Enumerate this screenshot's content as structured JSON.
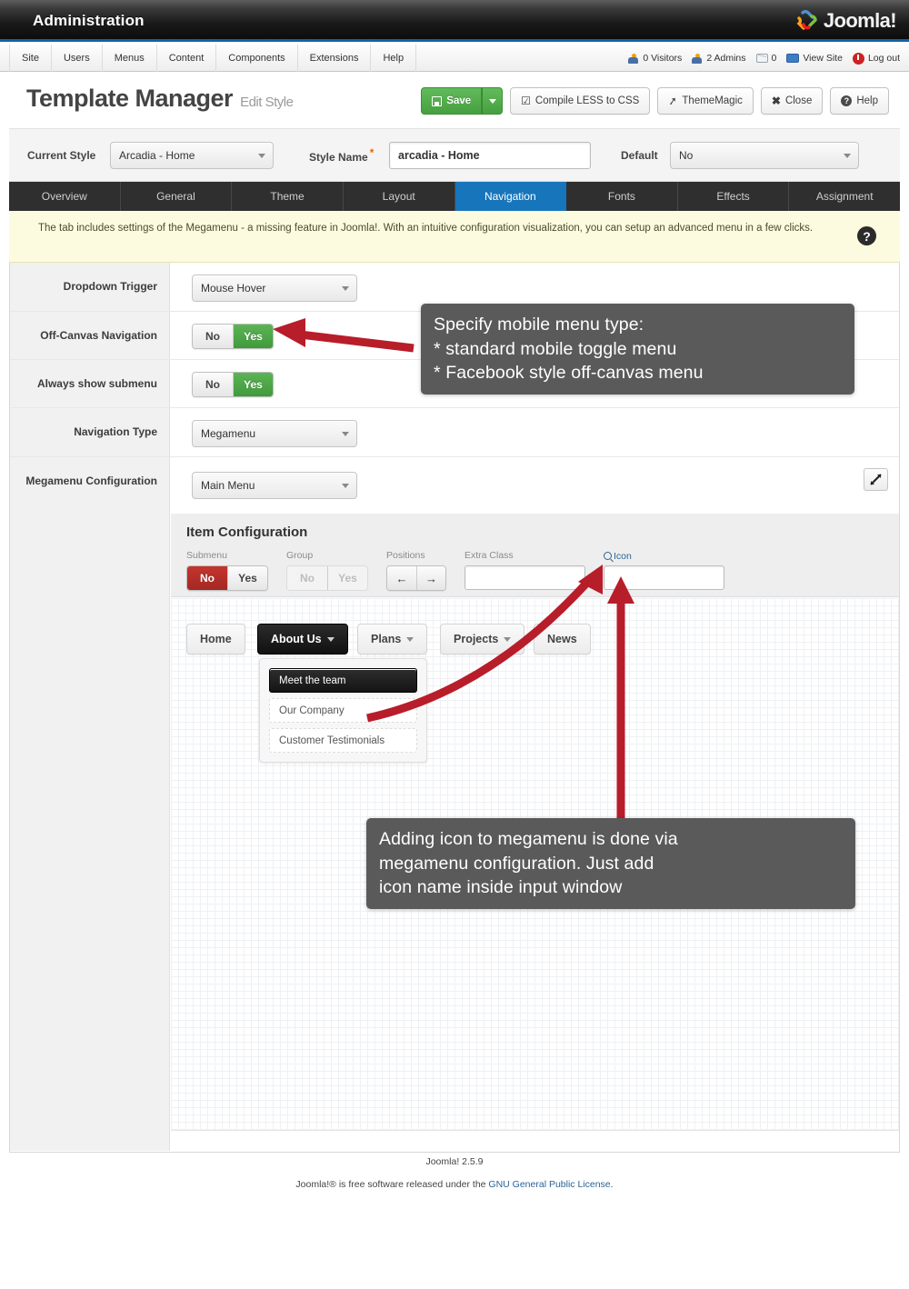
{
  "topbar": {
    "admin_title": "Administration",
    "logo_text": "Joomla!"
  },
  "menubar": {
    "items": [
      {
        "label": "Site"
      },
      {
        "label": "Users"
      },
      {
        "label": "Menus"
      },
      {
        "label": "Content"
      },
      {
        "label": "Components"
      },
      {
        "label": "Extensions"
      },
      {
        "label": "Help"
      }
    ],
    "status": [
      {
        "icon": "visitors-icon",
        "label": "0 Visitors"
      },
      {
        "icon": "admins-icon",
        "label": "2 Admins"
      },
      {
        "icon": "messages-icon",
        "label": "0"
      },
      {
        "icon": "view-site-icon",
        "label": "View Site"
      },
      {
        "icon": "logout-icon",
        "label": "Log out"
      }
    ]
  },
  "page": {
    "title": "Template Manager",
    "subtitle": "Edit Style"
  },
  "toolbar": {
    "save_label": "Save",
    "compile_label": "Compile LESS to CSS",
    "thememagic_label": "ThemeMagic",
    "close_label": "Close",
    "help_label": "Help"
  },
  "style_row": {
    "current_style_label": "Current Style",
    "current_style_value": "Arcadia - Home",
    "style_name_label": "Style Name",
    "style_name_required": "*",
    "style_name_value": "arcadia - Home",
    "default_label": "Default",
    "default_value": "No"
  },
  "tabs": [
    {
      "label": "Overview",
      "active": false
    },
    {
      "label": "General",
      "active": false
    },
    {
      "label": "Theme",
      "active": false
    },
    {
      "label": "Layout",
      "active": false
    },
    {
      "label": "Navigation",
      "active": true
    },
    {
      "label": "Fonts",
      "active": false
    },
    {
      "label": "Effects",
      "active": false
    },
    {
      "label": "Assignment",
      "active": false
    }
  ],
  "notice": {
    "text": "The tab includes settings of the Megamenu - a missing feature in Joomla!. With an intuitive configuration visualization, you can setup an advanced menu in a few clicks.",
    "help_glyph": "?"
  },
  "form": {
    "rows": [
      {
        "label": "Dropdown Trigger",
        "type": "select",
        "value": "Mouse Hover"
      },
      {
        "label": "Off-Canvas Navigation",
        "type": "toggle",
        "no": "No",
        "yes": "Yes",
        "selected": "yes"
      },
      {
        "label": "Always show submenu",
        "type": "toggle",
        "no": "No",
        "yes": "Yes",
        "selected": "yes"
      },
      {
        "label": "Navigation Type",
        "type": "select",
        "value": "Megamenu"
      },
      {
        "label": "Megamenu Configuration",
        "type": "select",
        "value": "Main Menu"
      }
    ]
  },
  "item_config": {
    "title": "Item Configuration",
    "submenu_label": "Submenu",
    "submenu_no": "No",
    "submenu_yes": "Yes",
    "group_label": "Group",
    "group_no": "No",
    "group_yes": "Yes",
    "positions_label": "Positions",
    "positions_left": "←",
    "positions_right": "→",
    "extra_class_label": "Extra Class",
    "extra_class_value": "",
    "icon_label": "Icon",
    "icon_value": ""
  },
  "menu_preview": {
    "items": [
      {
        "label": "Home",
        "has_caret": false,
        "selected": false
      },
      {
        "label": "About Us",
        "has_caret": true,
        "selected": true
      },
      {
        "label": "Plans",
        "has_caret": true,
        "selected": false
      },
      {
        "label": "Projects",
        "has_caret": true,
        "selected": false
      },
      {
        "label": "News",
        "has_caret": false,
        "selected": false
      }
    ],
    "submenu": [
      {
        "label": "Meet the team",
        "selected": true
      },
      {
        "label": "Our Company",
        "selected": false
      },
      {
        "label": "Customer Testimonials",
        "selected": false
      }
    ]
  },
  "callouts": [
    {
      "id": "offcanvas-callout",
      "lines": [
        "Specify mobile menu type:",
        "* standard mobile toggle menu",
        "* Facebook style off-canvas menu"
      ]
    },
    {
      "id": "icon-callout",
      "lines": [
        "Adding icon to megamenu is done via",
        "megamenu configuration. Just add",
        "icon name inside input window"
      ]
    }
  ],
  "footer": {
    "version": "Joomla! 2.5.9",
    "license_prefix": "Joomla!® is free software released under the ",
    "license_link": "GNU General Public License",
    "license_suffix": "."
  },
  "colors": {
    "accent_blue": "#1775bb",
    "green": "#45a03f",
    "red": "#a52722",
    "arrow_red": "#b81d2a",
    "callout_bg": "#5a5a5a",
    "notice_bg": "#fdfbdf"
  }
}
